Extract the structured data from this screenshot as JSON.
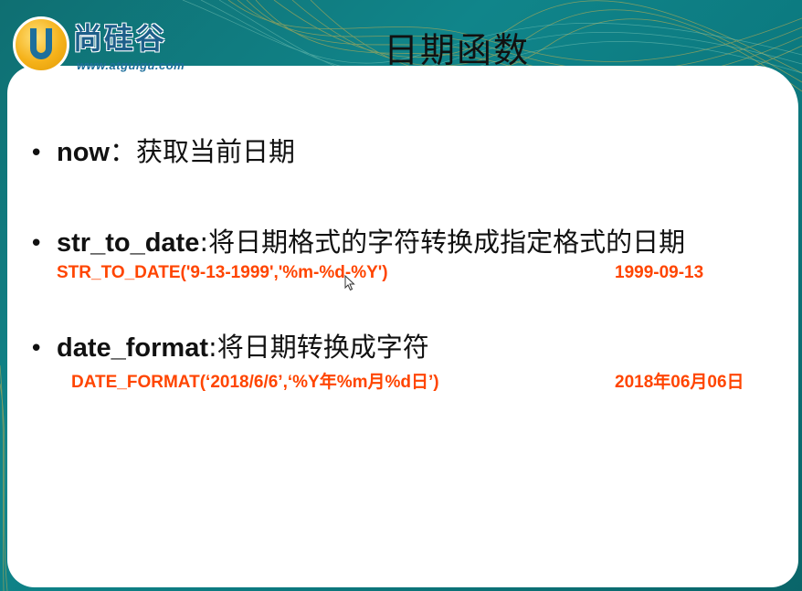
{
  "logo": {
    "name": "尚硅谷",
    "url": "www.atguigu.com"
  },
  "slide": {
    "title": "日期函数"
  },
  "items": [
    {
      "keyword": "now",
      "separator": "：",
      "description": "获取当前日期"
    },
    {
      "keyword": "str_to_date",
      "separator": ":",
      "description": "将日期格式的字符转换成指定格式的日期",
      "example": "STR_TO_DATE('9-13-1999','%m-%d-%Y')",
      "result": "1999-09-13"
    },
    {
      "keyword": "date_format",
      "separator": ":",
      "description": "将日期转换成字符",
      "example": "DATE_FORMAT(‘2018/6/6’,‘%Y年%m月%d日’)",
      "result": "2018年06月06日"
    }
  ],
  "colors": {
    "background_teal": "#0f7a7e",
    "accent_orange": "#ff4500",
    "logo_blue": "#1d6f9c",
    "logo_gold": "#f5b21a"
  },
  "icons": {
    "bullet": "bullet-dot",
    "cursor": "mouse-pointer-icon"
  }
}
